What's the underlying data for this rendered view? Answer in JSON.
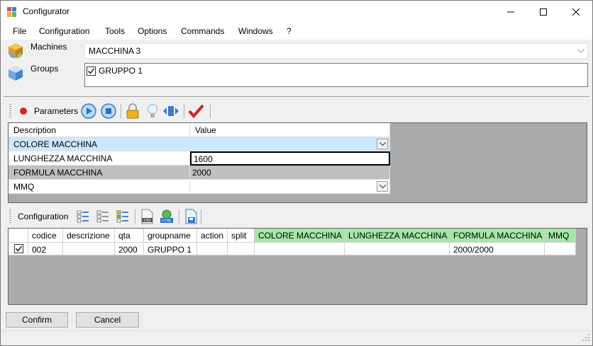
{
  "window": {
    "title": "Configurator"
  },
  "menu": [
    "File",
    "Configuration",
    "Tools",
    "Options",
    "Commands",
    "Windows",
    "?"
  ],
  "machines": {
    "label": "Machines",
    "selected": "MACCHINA 3"
  },
  "groups": {
    "label": "Groups",
    "items": [
      {
        "label": "GRUPPO 1",
        "checked": true
      }
    ]
  },
  "parameters": {
    "toolbar_label": "Parameters",
    "columns": [
      "Description",
      "Value"
    ],
    "rows": [
      {
        "description": "COLORE MACCHINA",
        "value": "",
        "dropdown": true
      },
      {
        "description": "LUNGHEZZA MACCHINA",
        "value": "1600",
        "dropdown": false
      },
      {
        "description": "FORMULA MACCHINA",
        "value": "2000",
        "dropdown": false
      },
      {
        "description": "MMQ",
        "value": "",
        "dropdown": true
      }
    ]
  },
  "configuration": {
    "toolbar_label": "Configuration",
    "columns": [
      "codice",
      "descrizione",
      "qta",
      "groupname",
      "action",
      "split",
      "COLORE MACCHINA",
      "LUNGHEZZA MACCHINA",
      "FORMULA MACCHINA",
      "MMQ"
    ],
    "rows": [
      {
        "checked": true,
        "cells": [
          "002",
          "",
          "2000",
          "GRUPPO 1",
          "",
          "",
          "",
          "",
          "2000/2000",
          ""
        ]
      }
    ]
  },
  "buttons": {
    "confirm": "Confirm",
    "cancel": "Cancel"
  },
  "colors": {
    "selected_row": "#cce8ff",
    "highlight_row": "#c0c0c0",
    "param_column_header": "#a6e6a6",
    "panel_bg": "#ababab"
  }
}
